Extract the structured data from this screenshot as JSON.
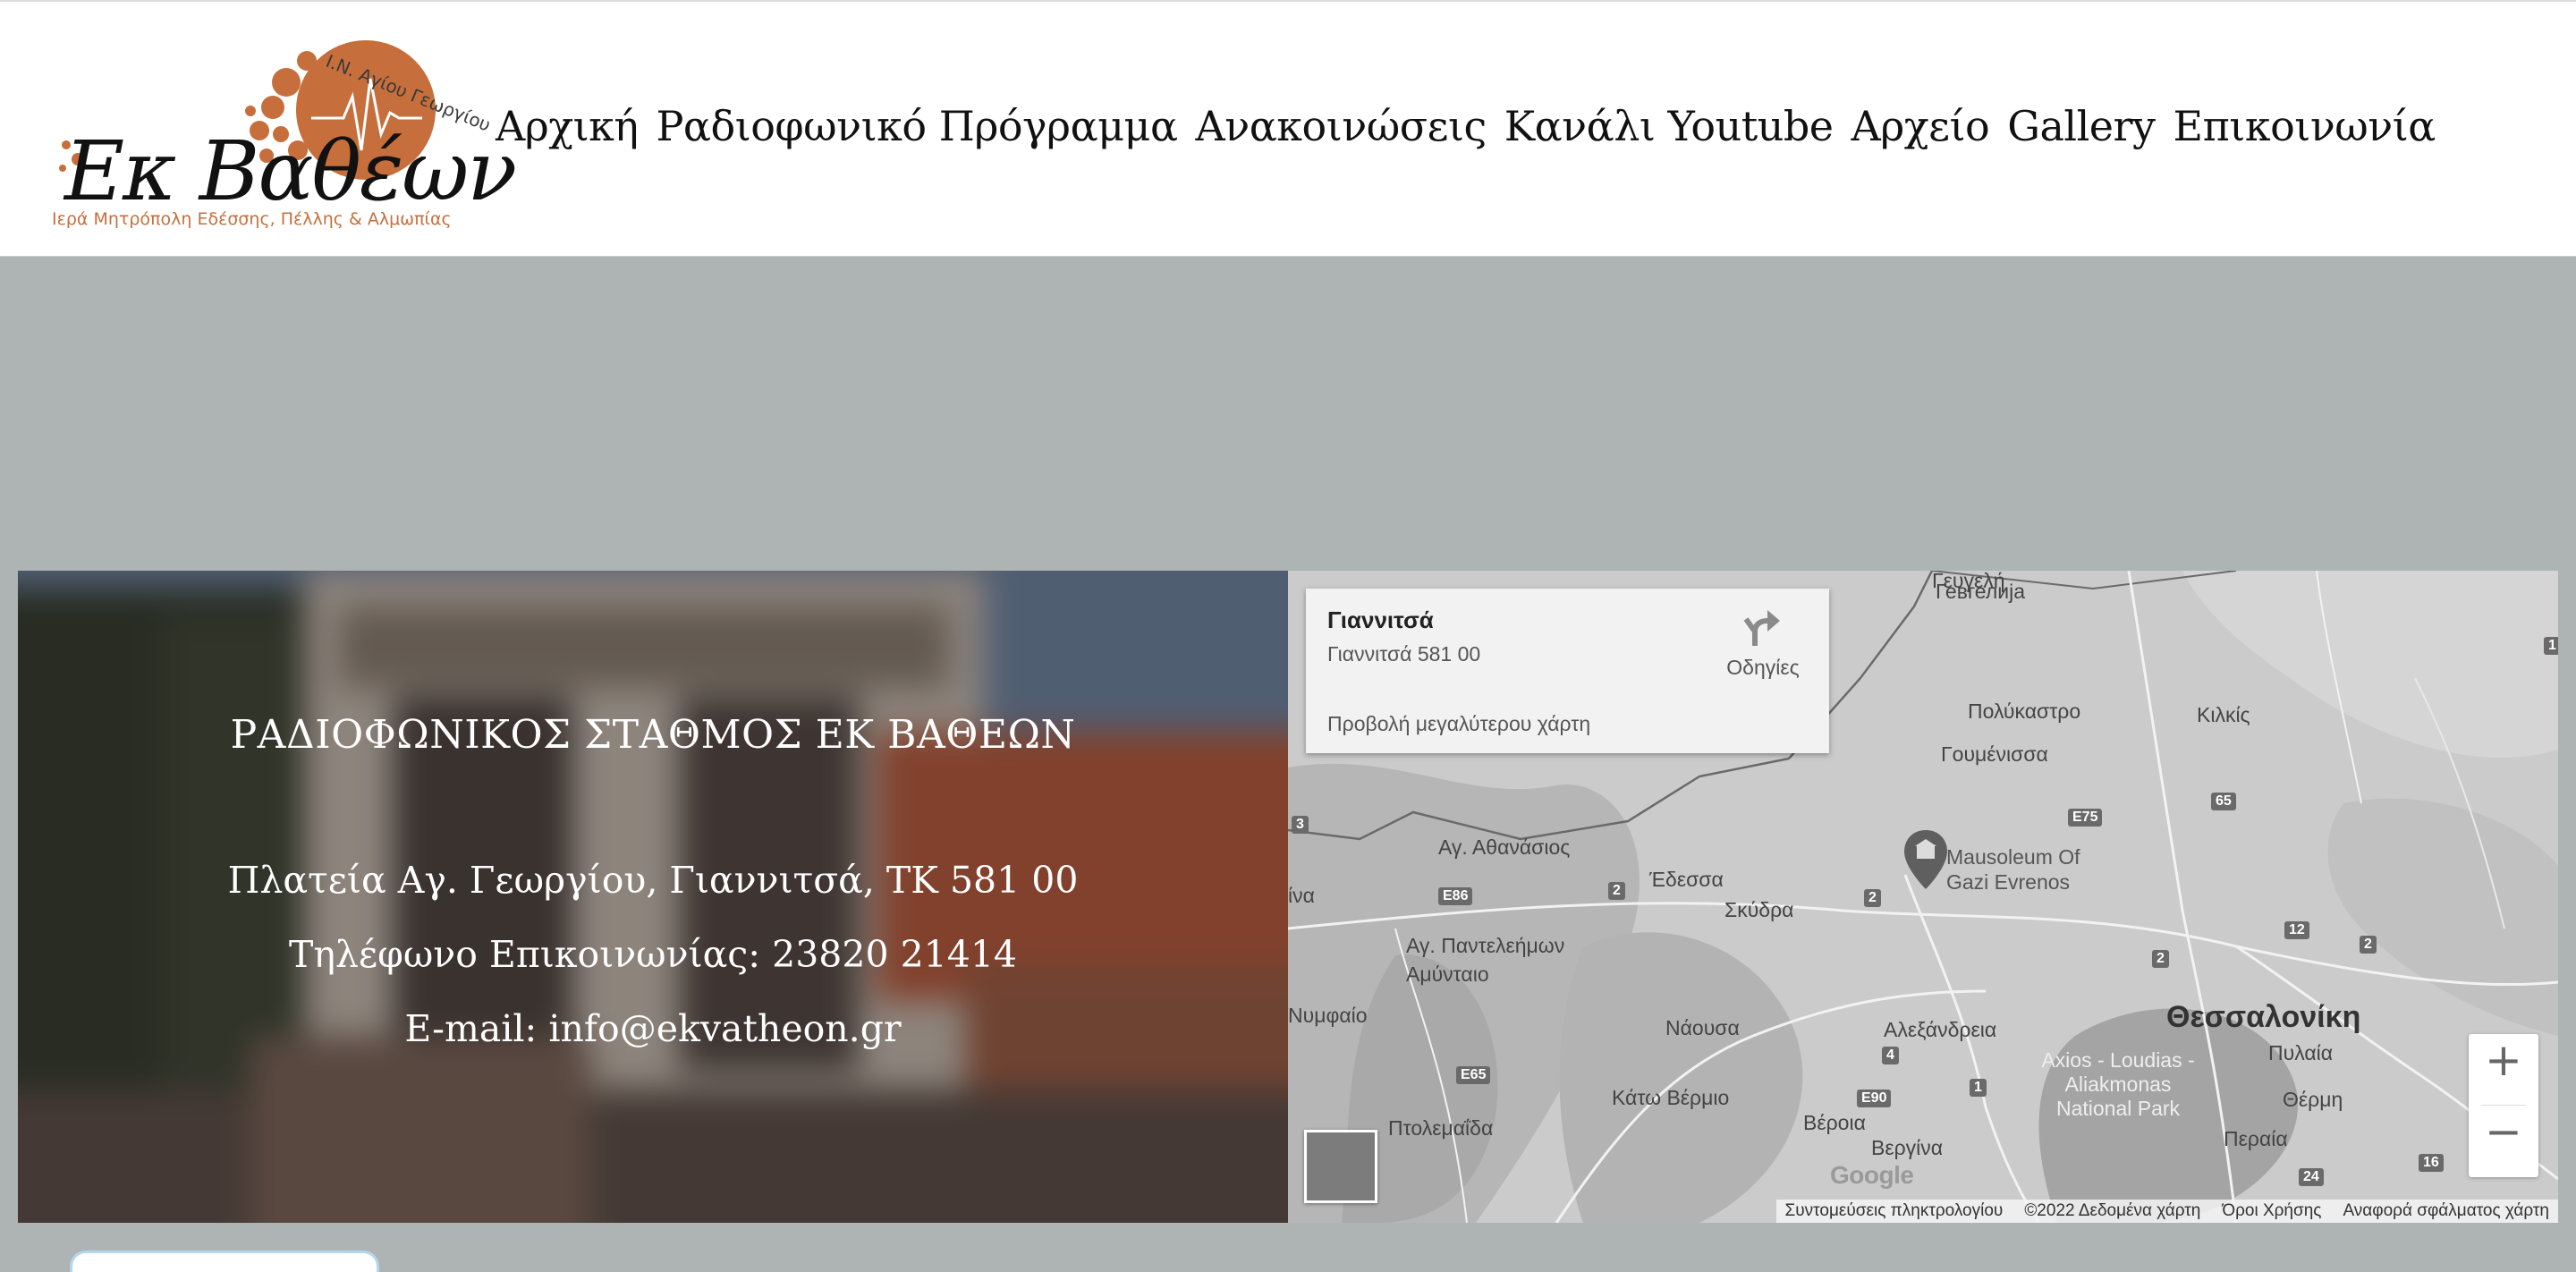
{
  "header": {
    "logo": {
      "top_text": "Ι.Ν. Αγίου Γεωργίου",
      "main_text": "Εκ Βαθέων",
      "sub_text": "Ιερά Μητρόπολη Εδέσσης, Πέλλης & Αλμωπίας",
      "brand_color": "#c66f3c"
    },
    "nav": [
      "Αρχική",
      "Ραδιοφωνικό  Πρόγραμμα",
      "Ανακοινώσεις",
      "Κανάλι  Youtube",
      "Αρχείο",
      "Gallery",
      "Επικοινωνία"
    ]
  },
  "contact": {
    "title": "ΡΑΔΙΟΦΩΝΙΚΟΣ ΣΤΑΘΜΟΣ ΕΚ ΒΑΘΕΩΝ",
    "address": "Πλατεία Αγ. Γεωργίου, Γιαννιτσά, ΤΚ 581 00",
    "phone": "Τηλέφωνο Επικοινωνίας: 23820 21414",
    "email": "E-mail: info@ekvatheon.gr"
  },
  "map": {
    "card": {
      "name": "Γιαννιτσά",
      "address": "Γιαννιτσά 581 00",
      "directions": "Οδηγίες",
      "larger_map": "Προβολή μεγαλύτερου χάρτη"
    },
    "places": {
      "gevgelija": "Гевгелија",
      "gevgelija_gr": "Γευγελή",
      "polykastro": "Πολύκαστρο",
      "kilkis": "Κιλκίς",
      "goumenissa": "Γουμένισσα",
      "ag_athanasios": "Αγ. Αθανάσιος",
      "edessa": "Έδεσσα",
      "skydra": "Σκύδρα",
      "mausoleum": "Mausoleum Of Gazi Evrenos",
      "ag_panteleimon": "Αγ. Παντελεήμων",
      "amyntaio": "Αμύνταιο",
      "nymfaio": "Νυμφαίο",
      "ima": "ίνα",
      "naousa": "Νάουσα",
      "alexandreia": "Αλεξάνδρεια",
      "thessaloniki": "Θεσσαλονίκη",
      "pylaia": "Πυλαία",
      "axios": "Axios - Loudias - Aliakmonas National Park",
      "thermi": "Θέρμη",
      "kato_vermio": "Κάτω Βέρμιο",
      "veroia": "Βέροια",
      "vergina": "Βεργίνα",
      "perai": "Περαία",
      "ptolemaida": "Πτολεμαΐδα"
    },
    "roads": [
      "E75",
      "65",
      "E86",
      "2",
      "2",
      "2",
      "12",
      "2",
      "3",
      "4",
      "E90",
      "1",
      "E65",
      "24",
      "16",
      "1"
    ],
    "zoom_in": "+",
    "zoom_out": "−",
    "google": "Google",
    "attribution": [
      "Συντομεύσεις πληκτρολογίου",
      "©2022 Δεδομένα χάρτη",
      "Όροι Χρήσης",
      "Αναφορά σφάλματος χάρτη"
    ]
  }
}
